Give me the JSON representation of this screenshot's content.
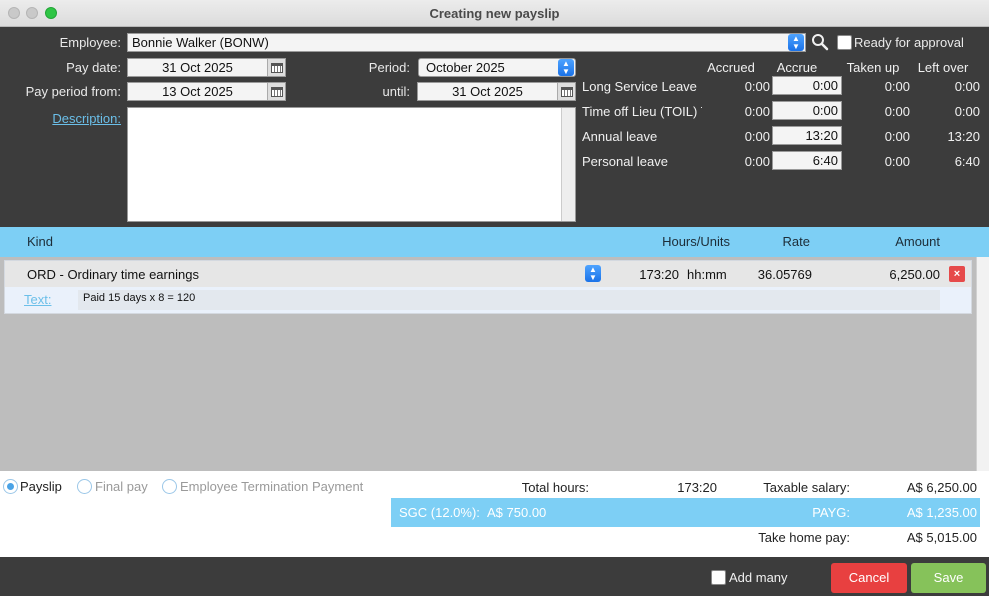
{
  "window": {
    "title": "Creating new payslip"
  },
  "header": {
    "employee_label": "Employee:",
    "employee_value": "Bonnie Walker (BONW)",
    "ready_label": "Ready for approval",
    "pay_date_label": "Pay date:",
    "pay_date_value": "31 Oct 2025",
    "period_label": "Period:",
    "period_value": "October 2025",
    "from_label": "Pay period from:",
    "from_value": "13 Oct 2025",
    "until_label": "until:",
    "until_value": "31 Oct 2025",
    "description_label": "Description:",
    "description_value": ""
  },
  "leave": {
    "columns": [
      "Accrued",
      "Accrue",
      "Taken up",
      "Left over"
    ],
    "rows": [
      {
        "name": "Long Service Leave",
        "accrued": "0:00",
        "accrue": "0:00",
        "taken": "0:00",
        "left": "0:00"
      },
      {
        "name": "Time off Lieu (TOIL) T",
        "accrued": "0:00",
        "accrue": "0:00",
        "taken": "0:00",
        "left": "0:00"
      },
      {
        "name": "Annual leave",
        "accrued": "0:00",
        "accrue": "13:20",
        "taken": "0:00",
        "left": "13:20"
      },
      {
        "name": "Personal leave",
        "accrued": "0:00",
        "accrue": "6:40",
        "taken": "0:00",
        "left": "6:40"
      }
    ]
  },
  "table": {
    "headers": {
      "kind": "Kind",
      "hours": "Hours/Units",
      "rate": "Rate",
      "amount": "Amount"
    },
    "rows": [
      {
        "kind": "ORD - Ordinary time earnings",
        "hours": "173:20",
        "unit": "hh:mm",
        "rate": "36.05769",
        "amount": "6,250.00",
        "delete": "×",
        "text_label": "Text:",
        "text_value": "Paid 15 days x 8 = 120"
      }
    ]
  },
  "summary": {
    "radio_payslip": "Payslip",
    "radio_final": "Final pay",
    "radio_etp": "Employee Termination Payment",
    "total_hours_label": "Total hours:",
    "total_hours_value": "173:20",
    "taxable_label": "Taxable salary:",
    "taxable_value": "A$ 6,250.00",
    "sgc_label": "SGC (12.0%):",
    "sgc_value": "A$ 750.00",
    "payg_label": "PAYG:",
    "payg_value": "A$ 1,235.00",
    "takehome_label": "Take home pay:",
    "takehome_value": "A$ 5,015.00"
  },
  "footer": {
    "add_many_label": "Add many",
    "cancel_label": "Cancel",
    "save_label": "Save"
  },
  "colors": {
    "accent_blue": "#7dcff5",
    "cancel_red": "#e84040",
    "save_green": "#86c25a",
    "dark_bg": "#3c3c3c"
  }
}
